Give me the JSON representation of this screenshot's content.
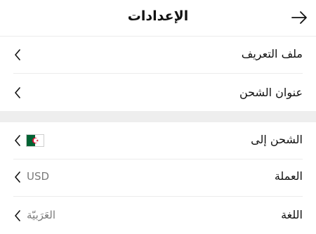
{
  "header": {
    "title": "الإعدادات",
    "back_icon": "arrow-right-icon"
  },
  "sections": [
    {
      "items": [
        {
          "label": "ملف التعريف",
          "icon": "chevron-left-icon"
        },
        {
          "label": "عنوان الشحن",
          "icon": "chevron-left-icon"
        }
      ]
    },
    {
      "items": [
        {
          "label": "الشحن إلى",
          "flag": "algeria-flag-icon",
          "icon": "chevron-left-icon"
        },
        {
          "label": "العملة",
          "value": "USD",
          "icon": "chevron-left-icon"
        },
        {
          "label": "اللغة",
          "value": "العَرَبيّة",
          "icon": "chevron-left-icon"
        }
      ]
    }
  ],
  "colors": {
    "text": "#111111",
    "muted": "#7a7a7a",
    "divider": "#ececec",
    "section_gap": "#eeeeee",
    "flag_green": "#006233",
    "flag_red": "#d21034"
  }
}
